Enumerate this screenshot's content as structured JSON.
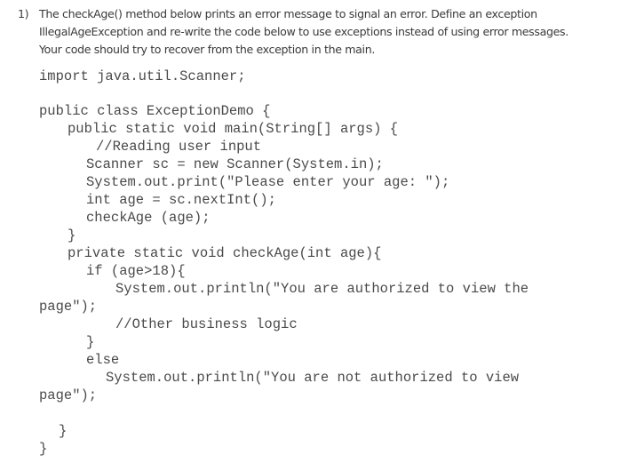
{
  "question": {
    "number": "1)",
    "lines": [
      "The checkAge() method below prints an error message to signal an error. Define an exception",
      "IllegalAgeException and re-write the code below to use exceptions instead of using error messages.",
      "Your code should try to recover from the exception in the main."
    ]
  },
  "code": {
    "lines": [
      "import java.util.Scanner;",
      "public class ExceptionDemo {",
      "public static void main(String[] args) {",
      "//Reading user input",
      "Scanner sc = new Scanner(System.in);",
      "System.out.print(\"Please enter your age: \");",
      "int age = sc.nextInt();",
      "checkAge (age);",
      "}",
      "private static void checkAge(int age){",
      "if (age>18){",
      "System.out.println(\"You are authorized to view the",
      "page\");",
      "//Other business logic",
      "}",
      "else",
      "System.out.println(\"You are not authorized to view",
      "page\");",
      "}",
      "}"
    ]
  }
}
